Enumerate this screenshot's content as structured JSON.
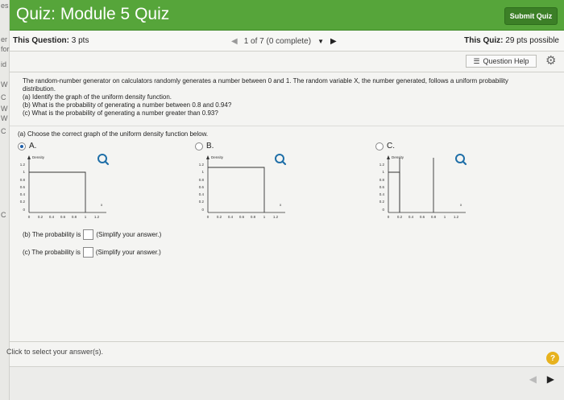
{
  "left_sliver": [
    "es",
    "er",
    "for",
    "id",
    "W",
    "C",
    "W",
    "W",
    "C",
    "C"
  ],
  "header": {
    "title": "Quiz: Module 5 Quiz",
    "submit_label": "Submit Quiz"
  },
  "infobar": {
    "question_label": "This Question:",
    "question_points": "3 pts",
    "progress": "1 of 7 (0 complete)",
    "quiz_label": "This Quiz:",
    "quiz_points": "29 pts possible"
  },
  "help": {
    "label": "Question Help"
  },
  "question": {
    "intro": "The random-number generator on calculators randomly generates a number between 0 and 1. The random variable X, the number generated, follows a uniform probability distribution.",
    "part_a": "(a) Identify the graph of the uniform density function.",
    "part_b": "(b) What is the probability of generating a number between 0.8 and 0.94?",
    "part_c": "(c) What is the probability of generating a number greater than 0.93?",
    "prompt_a": "(a) Choose the correct graph of the uniform density function below."
  },
  "options": [
    {
      "label": "A.",
      "selected": true
    },
    {
      "label": "B.",
      "selected": false
    },
    {
      "label": "C.",
      "selected": false
    }
  ],
  "graph": {
    "axis_title": "Density",
    "y_ticks_a": [
      "1.2",
      "1",
      "0.8",
      "0.6",
      "0.4",
      "0.2",
      "0"
    ],
    "y_ticks_bc": [
      "1.2",
      "1",
      "0.8",
      "0.6",
      "0.4",
      "0.2",
      "0"
    ],
    "x_ticks": [
      "0",
      "0.2",
      "0.4",
      "0.6",
      "0.8",
      "1",
      "1.2"
    ],
    "x_var": "x"
  },
  "answers": {
    "b_prefix": "(b) The probability is",
    "b_suffix": "(Simplify your answer.)",
    "c_prefix": "(c) The probability is",
    "c_suffix": "(Simplify your answer.)"
  },
  "footer": {
    "note": "Click to select your answer(s)."
  },
  "colors": {
    "header": "#56a53a",
    "accent": "#1f5fa8"
  }
}
